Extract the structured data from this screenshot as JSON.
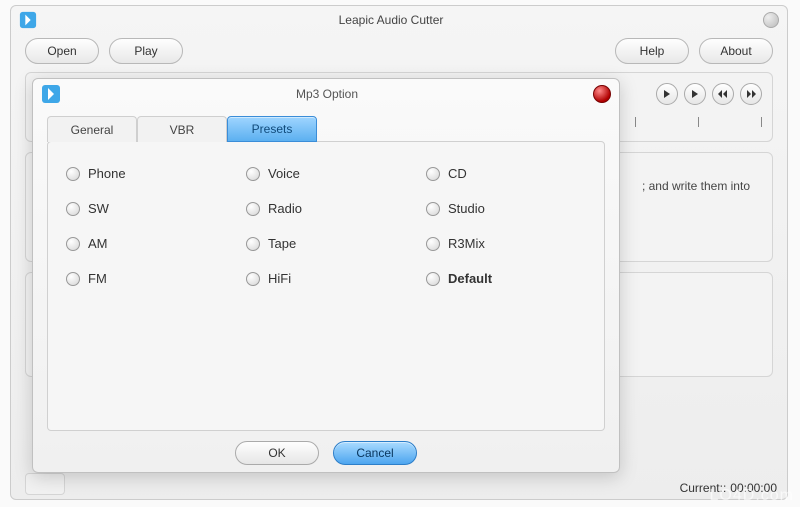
{
  "main": {
    "title": "Leapic Audio Cutter",
    "toolbar": {
      "open": "Open",
      "play": "Play",
      "help": "Help",
      "about": "About"
    },
    "playback_icons": {
      "play": "▶",
      "stop": "▶",
      "rew": "≪",
      "ffw": "≫"
    },
    "info_text": "; and write them into",
    "status": {
      "label": "Current::",
      "value": "00:00:00"
    }
  },
  "dialog": {
    "title": "Mp3 Option",
    "tabs": {
      "general": "General",
      "vbr": "VBR",
      "presets": "Presets"
    },
    "active_tab": "presets",
    "presets": [
      {
        "key": "phone",
        "label": "Phone"
      },
      {
        "key": "voice",
        "label": "Voice"
      },
      {
        "key": "cd",
        "label": "CD"
      },
      {
        "key": "sw",
        "label": "SW"
      },
      {
        "key": "radio",
        "label": "Radio"
      },
      {
        "key": "studio",
        "label": "Studio"
      },
      {
        "key": "am",
        "label": "AM"
      },
      {
        "key": "tape",
        "label": "Tape"
      },
      {
        "key": "r3mix",
        "label": "R3Mix"
      },
      {
        "key": "fm",
        "label": "FM"
      },
      {
        "key": "hifi",
        "label": "HiFi"
      },
      {
        "key": "default",
        "label": "Default",
        "bold": true
      }
    ],
    "buttons": {
      "ok": "OK",
      "cancel": "Cancel"
    }
  },
  "watermark": "LO4D.com"
}
